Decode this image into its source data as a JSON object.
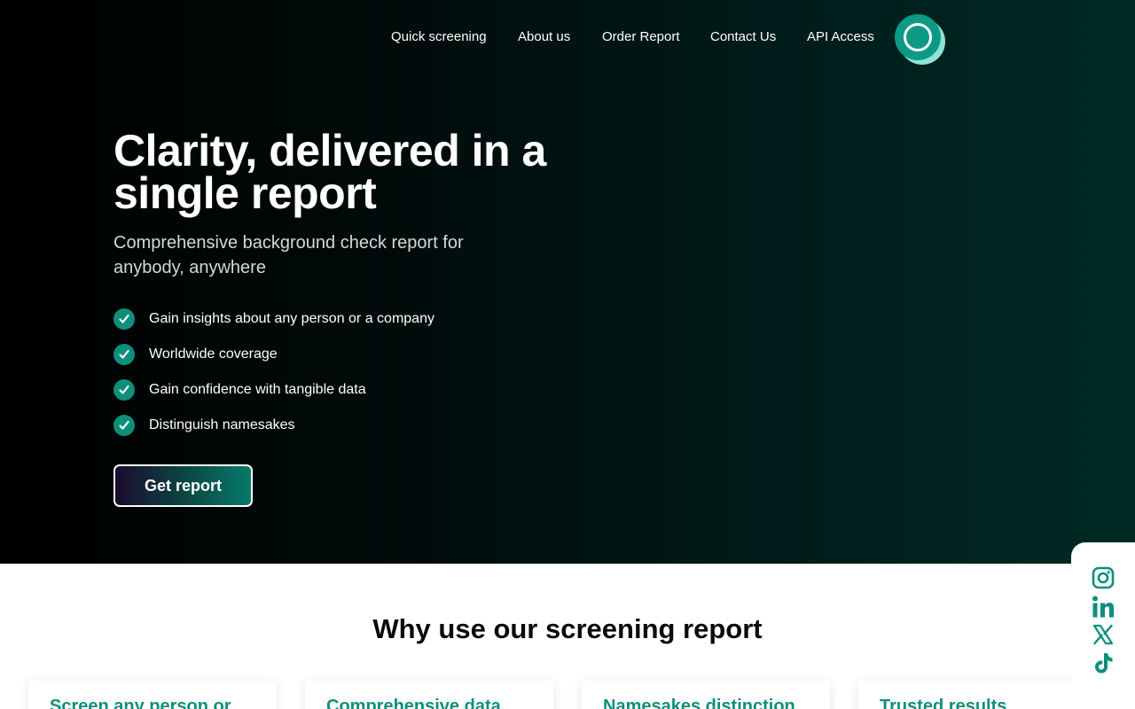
{
  "nav": {
    "links": [
      "Quick screening",
      "About us",
      "Order Report",
      "Contact Us",
      "API Access"
    ]
  },
  "hero": {
    "headline": "Clarity, delivered in a single report",
    "subhead": "Comprehensive background check report for anybody, anywhere",
    "features": [
      "Gain insights about any person or a company",
      "Worldwide coverage",
      "Gain confidence with tangible data",
      "Distinguish namesakes"
    ],
    "cta_label": "Get report"
  },
  "why": {
    "title": "Why use our screening report",
    "cards": [
      "Screen any person or",
      "Comprehensive data",
      "Namesakes distinction",
      "Trusted results"
    ]
  },
  "social": {
    "icons": [
      "instagram-icon",
      "linkedin-icon",
      "x-icon",
      "tiktok-icon"
    ]
  },
  "colors": {
    "accent": "#0d8f7c",
    "hero_dark": "#000000",
    "hero_teal": "#002a25"
  }
}
